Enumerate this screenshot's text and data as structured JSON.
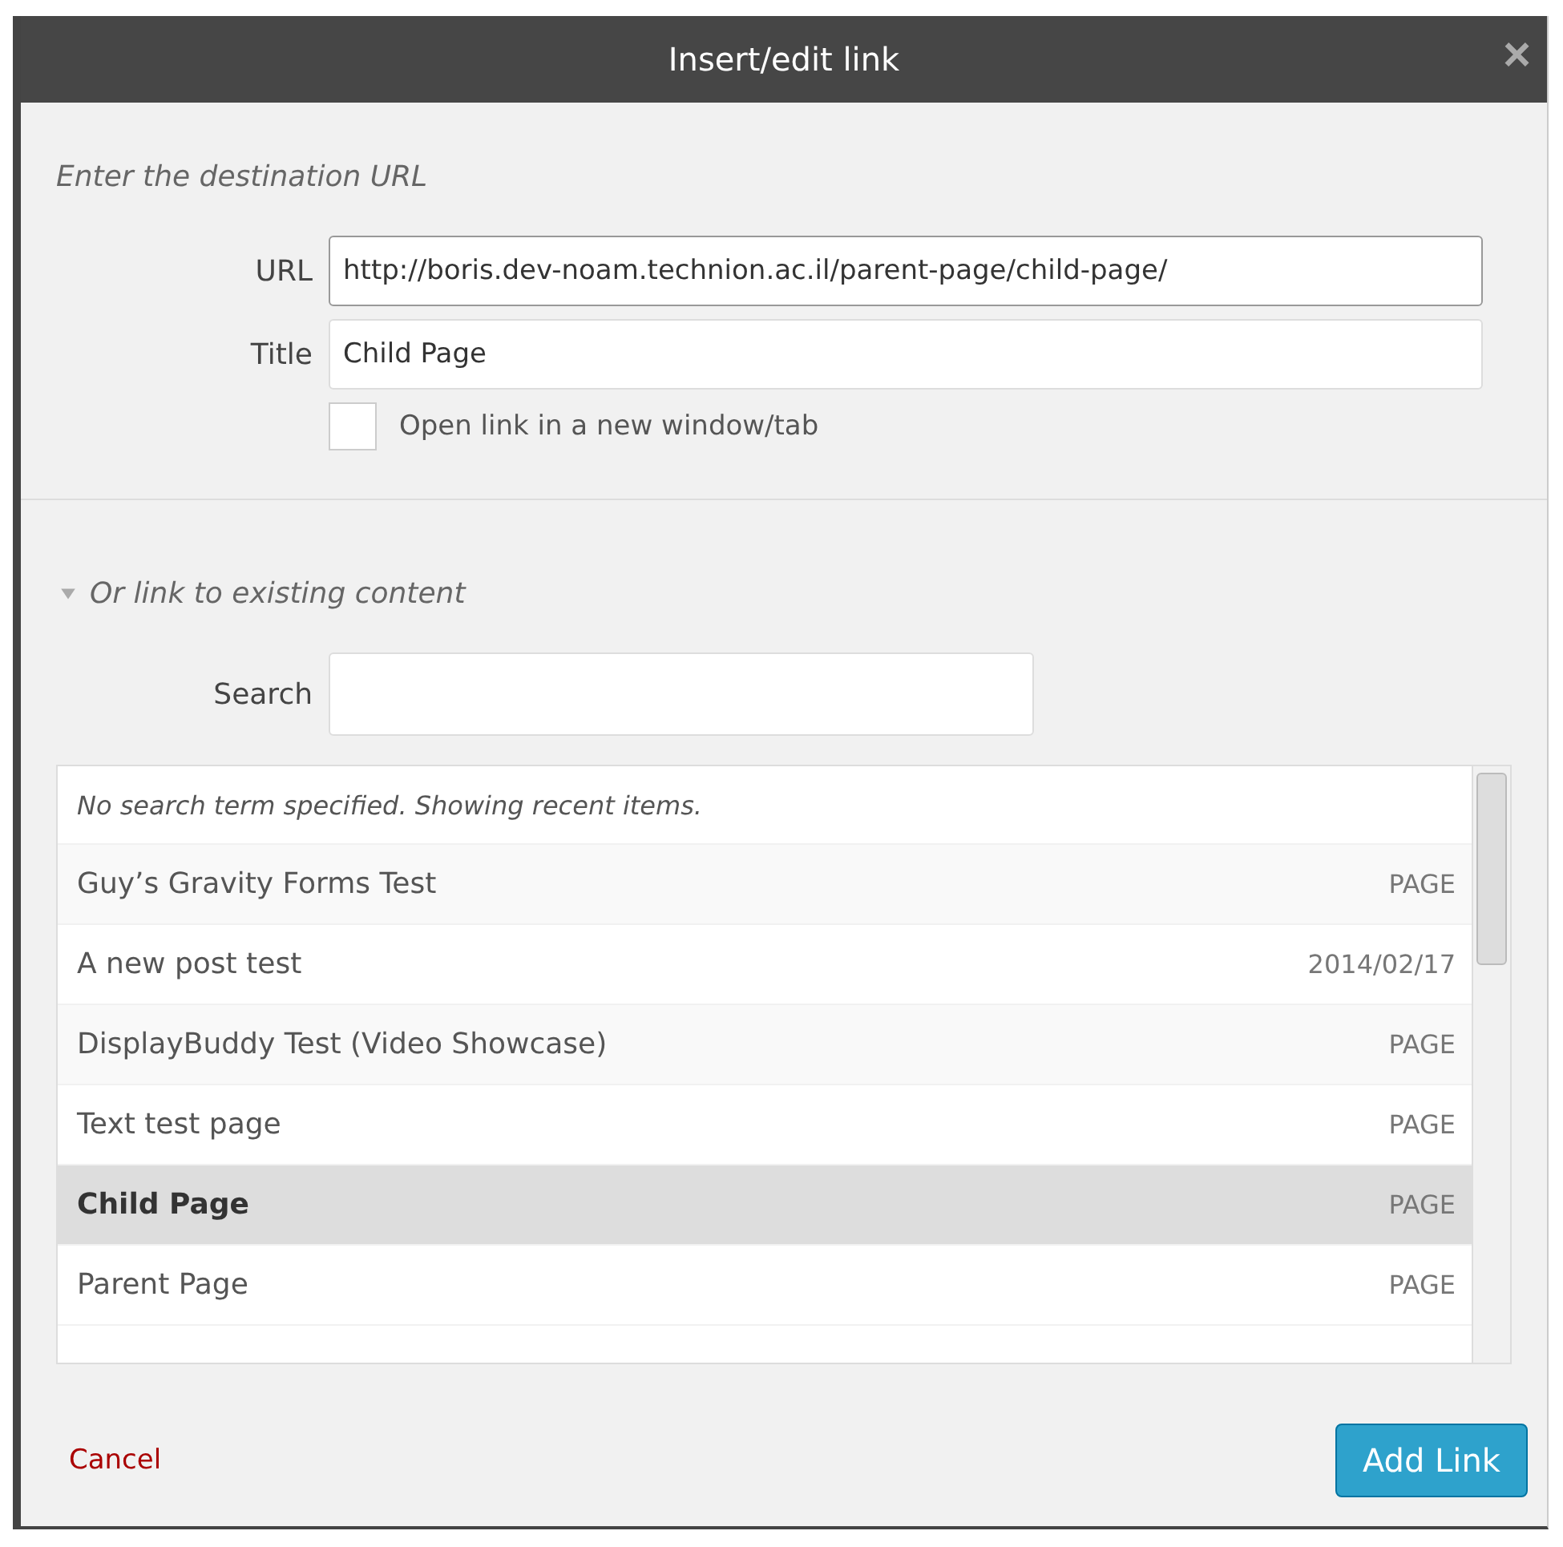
{
  "window": {
    "title": "Insert/edit link",
    "close": "×"
  },
  "url_section": {
    "heading": "Enter the destination URL",
    "url": {
      "label": "URL",
      "value": "http://boris.dev-noam.technion.ac.il/parent-page/child-page/"
    },
    "title": {
      "label": "Title",
      "value": "Child Page"
    },
    "new_tab": {
      "label": "Open link in a new window/tab",
      "checked": false
    }
  },
  "existing_content": {
    "toggle": "Or link to existing content",
    "expanded": true,
    "search": {
      "label": "Search"
    },
    "notice": "No search term specified. Showing recent items.",
    "results": [
      {
        "title": "Guy’s Gravity Forms Test",
        "info": "PAGE",
        "selected": false
      },
      {
        "title": "A new post test",
        "info": "2014/02/17",
        "selected": false
      },
      {
        "title": "DisplayBuddy Test (Video Showcase)",
        "info": "PAGE",
        "selected": false
      },
      {
        "title": "Text test page",
        "info": "PAGE",
        "selected": false
      },
      {
        "title": "Child Page",
        "info": "PAGE",
        "selected": true
      },
      {
        "title": "Parent Page",
        "info": "PAGE",
        "selected": false
      }
    ]
  },
  "buttons": {
    "cancel": "Cancel",
    "submit": "Add Link"
  }
}
